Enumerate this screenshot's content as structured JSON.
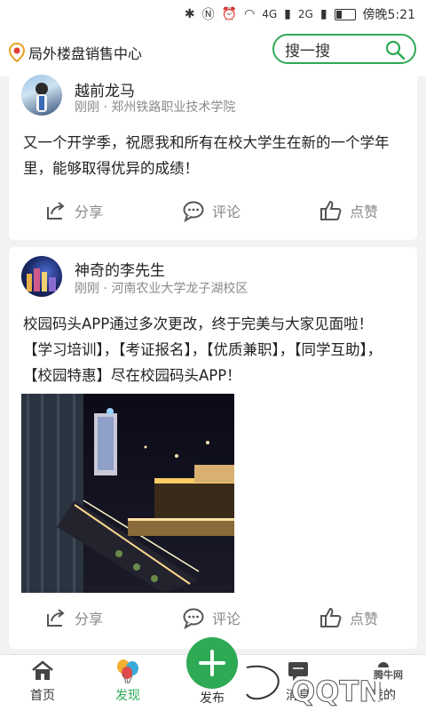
{
  "statusbar": {
    "carrier": "傍晚5:21",
    "signal1": "4G",
    "signal2": "2G"
  },
  "header": {
    "location": "局外楼盘销售中心",
    "search_placeholder": "搜一搜"
  },
  "posts": [
    {
      "name": "越前龙马",
      "meta": "刚刚 · 郑州铁路职业技术学院",
      "content": "又一个开学季，祝愿我和所有在校大学生在新的一个学年里，能够取得优异的成绩！",
      "actions": {
        "share": "分享",
        "comment": "评论",
        "like": "点赞"
      }
    },
    {
      "name": "神奇的李先生",
      "meta": "刚刚 · 河南农业大学龙子湖校区",
      "content": "校园码头APP通过多次更改，终于完美与大家见面啦！【学习培训】，【考证报名】，【优质兼职】，【同学互助】，【校园特惠】尽在校园码头APP！",
      "actions": {
        "share": "分享",
        "comment": "评论",
        "like": "点赞"
      }
    }
  ],
  "tabs": {
    "home": "首页",
    "discover": "发现",
    "publish": "发布",
    "message": "消息",
    "mine": "我的"
  },
  "watermark": {
    "brand": "QQTN",
    "sub": "腾牛网",
    "domain": ".com"
  },
  "colors": {
    "accent": "#2eaa55",
    "bg": "#f2f2f2"
  }
}
